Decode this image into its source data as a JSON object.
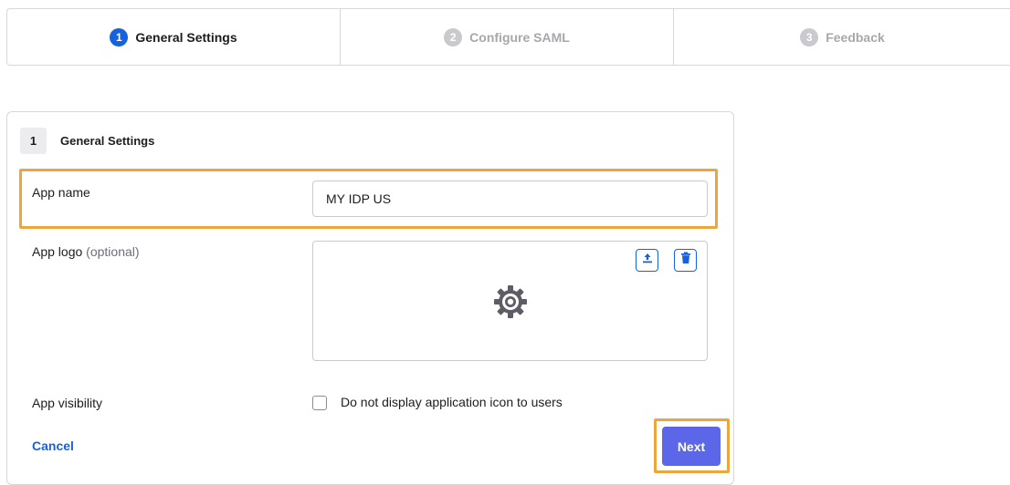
{
  "stepper": {
    "steps": [
      {
        "number": "1",
        "label": "General Settings",
        "state": "active"
      },
      {
        "number": "2",
        "label": "Configure SAML",
        "state": "inactive"
      },
      {
        "number": "3",
        "label": "Feedback",
        "state": "inactive"
      }
    ]
  },
  "section": {
    "number": "1",
    "title": "General Settings"
  },
  "form": {
    "app_name": {
      "label": "App name",
      "value": "MY IDP US"
    },
    "app_logo": {
      "label": "App logo",
      "optional": "(optional)",
      "upload_icon": "upload-icon",
      "delete_icon": "trash-icon",
      "placeholder_icon": "gear-icon"
    },
    "app_visibility": {
      "label": "App visibility",
      "checkbox_label": "Do not display application icon to users",
      "checked": false
    }
  },
  "actions": {
    "cancel_label": "Cancel",
    "next_label": "Next"
  },
  "colors": {
    "primary": "#1662dd",
    "next_button": "#5b66e8",
    "highlight": "#eba73b",
    "inactive": "#a7a7ad"
  }
}
